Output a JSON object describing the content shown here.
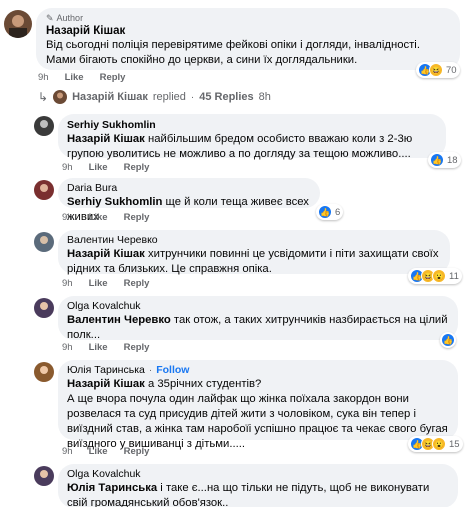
{
  "colors": {
    "bubble": "#f0f2f5",
    "link": "#1877f2",
    "meta": "#65676b",
    "like": "#1877f2",
    "haha": "#f7b928"
  },
  "main": {
    "author_badge": "Author",
    "name": "Назарій Кішак",
    "text": "Від сьогодні поліція перевірятиме фейкові опіки і догляди, інвалідності. Мами бігають спокійно до церкви, а сини їх доглядальники.",
    "time": "9h",
    "like": "Like",
    "reply": "Reply",
    "reaction_count": "70",
    "reactions": [
      "like-icon",
      "haha-icon"
    ]
  },
  "replies_summary": {
    "name": "Назарій Кішак",
    "label": "replied",
    "count": "45 Replies",
    "time": "8h"
  },
  "replies": [
    {
      "name": "Serhiy Sukhomlin",
      "mention": "Назарій Кішак",
      "text": " найбільшим бредом особисто вважаю коли з 2-3ю групою уволитись не можливо а по догляду за тещою можливо....",
      "time": "9h",
      "like": "Like",
      "reply": "Reply",
      "reaction_count": "18"
    },
    {
      "name": "Daria Bura",
      "mention": "Serhiy Sukhomlin",
      "text": " ще й коли теща живеє всех живих",
      "time": "9h",
      "like": "Like",
      "reply": "Reply",
      "reaction_count": "6"
    },
    {
      "name": "Валентин Черевко",
      "mention": "Назарій Кішак",
      "text": " хитрунчики повинні це усвідомити і піти захищати своїх рідних та близьких. Це справжня опіка.",
      "time": "9h",
      "like": "Like",
      "reply": "Reply",
      "reaction_count": "11"
    },
    {
      "name": "Olga Kovalchuk",
      "mention": "Валентин Черевко",
      "text": " так отож, а таких хитрунчиків назбирається на цілий полк...",
      "time": "9h",
      "like": "Like",
      "reply": "Reply",
      "reaction_count": ""
    },
    {
      "name": "Юлія Таринська",
      "follow": "Follow",
      "mention": "Назарій Кішак",
      "text_after_mention": " а 35річних студентів?",
      "text": "А ще вчора почула один лайфак що жінка поїхала закордон вони розвелася та суд присудив дітей жити з чоловіком, сука він тепер і виїздний став, а жінка там наробоїі успішно працює та чекає свого бугая виїздного у вишиванці з дітьми.....",
      "time": "9h",
      "like": "Like",
      "reply": "Reply",
      "reaction_count": "15"
    },
    {
      "name": "Olga Kovalchuk",
      "mention": "Юлія Таринська",
      "text": " і таке є...на що тільки не підуть, щоб не виконувати свій громадянський обов'язок..",
      "time": "",
      "like": "",
      "reply": "",
      "reaction_count": ""
    }
  ]
}
